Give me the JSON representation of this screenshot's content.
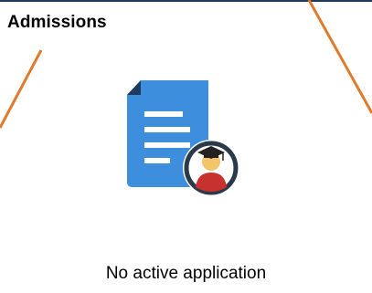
{
  "tile": {
    "title": "Admissions",
    "status": "No active application"
  },
  "icons": {
    "main": "application-document-graduate-icon"
  },
  "colors": {
    "document": "#3d8fde",
    "document_fold": "#1f3a5f",
    "document_lines": "#ffffff",
    "badge_ring": "#2b3a4a",
    "graduate_robe": "#c8322e",
    "graduate_face": "#f2c56b",
    "cap": "#222222",
    "annotation_lines": "#e07b2c"
  }
}
